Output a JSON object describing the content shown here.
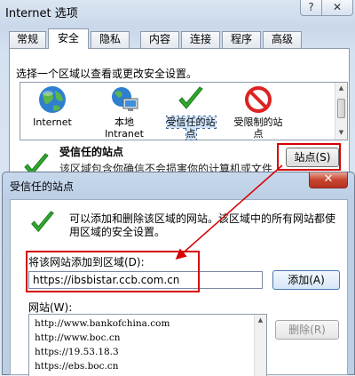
{
  "outer_window": {
    "title": "Internet 选项",
    "help_label": "?",
    "close_label": "✕"
  },
  "tabs": [
    {
      "label": "常规",
      "active": false
    },
    {
      "label": "安全",
      "active": true
    },
    {
      "label": "隐私",
      "active": false
    },
    {
      "label": "内容",
      "active": false
    },
    {
      "label": "连接",
      "active": false
    },
    {
      "label": "程序",
      "active": false
    },
    {
      "label": "高级",
      "active": false
    }
  ],
  "security": {
    "zone_prompt": "选择一个区域以查看或更改安全设置。",
    "zones": [
      {
        "label": "Internet",
        "icon": "globe-icon"
      },
      {
        "label": "本地\nIntranet",
        "icon": "intranet-icon"
      },
      {
        "label": "受信任的站\n点",
        "icon": "check-icon",
        "selected": true
      },
      {
        "label": "受限制的站\n点",
        "icon": "restricted-icon"
      }
    ],
    "trusted_heading": "受信任的站点",
    "trusted_desc": "该区域包含你确信不会损害你的计算机或文件",
    "sites_button": "站点(S)"
  },
  "inner_dialog": {
    "title": "受信任的站点",
    "close_label": "✕",
    "info_line1": "可以添加和删除该区域的网站。该区域中的所有网站都使",
    "info_line2": "用区域的安全设置。",
    "add_label": "将该网站添加到区域(D):",
    "url_value": "https://ibsbistar.ccb.com.cn",
    "add_button": "添加(A)",
    "sites_label": "网站(W):",
    "sites": [
      "http://www.bankofchina.com",
      "http://www.boc.cn",
      "https://19.53.18.3",
      "https://ebs.boc.cn"
    ],
    "remove_button": "删除(R)"
  },
  "colors": {
    "annotation_red": "#d60000",
    "check_green": "#2fa82f"
  }
}
